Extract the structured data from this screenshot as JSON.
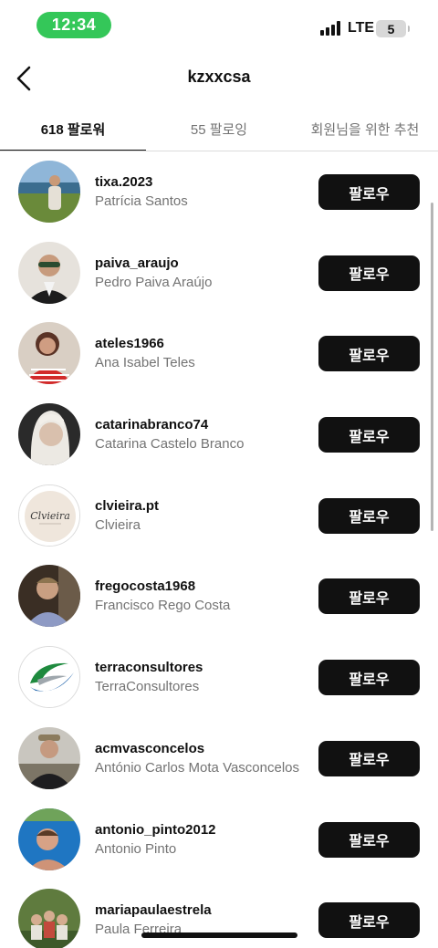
{
  "status_bar": {
    "time": "12:34",
    "network": "LTE",
    "battery": "5",
    "time_color": "#34c759"
  },
  "header": {
    "title": "kzxxcsa",
    "back_icon": "chevron-left-icon"
  },
  "tabs": [
    {
      "label": "618 팔로워",
      "active": true
    },
    {
      "label": "55 팔로잉",
      "active": false
    },
    {
      "label": "회원님을 위한 추천",
      "active": false
    }
  ],
  "follow_label": "팔로우",
  "followers": [
    {
      "username": "tixa.2023",
      "full_name": "Patrícia Santos",
      "follow_label": "팔로우"
    },
    {
      "username": "paiva_araujo",
      "full_name": "Pedro Paiva Araújo",
      "follow_label": "팔로우"
    },
    {
      "username": "ateles1966",
      "full_name": "Ana Isabel Teles",
      "follow_label": "팔로우"
    },
    {
      "username": "catarinabranco74",
      "full_name": "Catarina  Castelo Branco",
      "follow_label": "팔로우"
    },
    {
      "username": "clvieira.pt",
      "full_name": "Clvieira",
      "follow_label": "팔로우",
      "avatar_text": "Clvieira"
    },
    {
      "username": "fregocosta1968",
      "full_name": "Francisco Rego Costa",
      "follow_label": "팔로우"
    },
    {
      "username": "terraconsultores",
      "full_name": "TerraConsultores",
      "follow_label": "팔로우"
    },
    {
      "username": "acmvasconcelos",
      "full_name": "António Carlos Mota Vasconcelos",
      "follow_label": "팔로우"
    },
    {
      "username": "antonio_pinto2012",
      "full_name": "Antonio Pinto",
      "follow_label": "팔로우"
    },
    {
      "username": "mariapaulaestrela",
      "full_name": "Paula Ferreira",
      "follow_label": "팔로우"
    }
  ]
}
